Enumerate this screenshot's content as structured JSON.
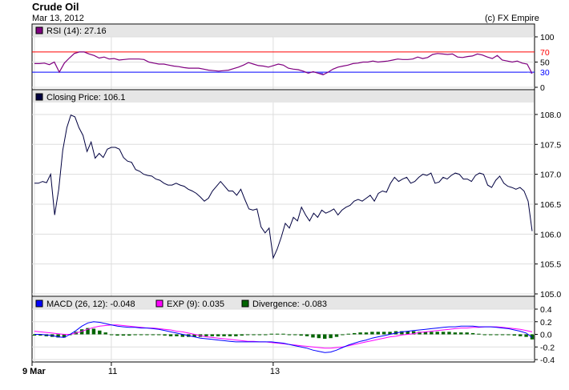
{
  "header": {
    "title": "Crude Oil",
    "date": "Mar 13, 2012",
    "credit": "(c) FX Empire"
  },
  "colors": {
    "rsi": "#800080",
    "price": "#000040",
    "macd": "#0000ff",
    "exp": "#ff00ff",
    "divergence": "#006400",
    "overbought": "#ff0000",
    "oversold": "#0000ff",
    "legend_bg": "#e6e6e6",
    "grid": "#dddddd"
  },
  "x_axis": {
    "ticks": [
      {
        "label": "9 Mar",
        "index": 0
      },
      {
        "label": "11",
        "index": 19
      },
      {
        "label": "13",
        "index": 59
      }
    ]
  },
  "chart_data": [
    {
      "type": "line",
      "legend": "RSI (14): 27.16",
      "ylim": [
        0,
        100
      ],
      "yticks": [
        0,
        50,
        100
      ],
      "level_labels": [
        70,
        30
      ],
      "overbought": 70,
      "oversold": 30,
      "values": [
        47,
        47,
        48,
        45,
        50,
        30,
        48,
        58,
        67,
        70,
        70,
        66,
        63,
        58,
        60,
        56,
        57,
        54,
        55,
        56,
        56,
        56,
        55,
        50,
        48,
        46,
        46,
        44,
        42,
        41,
        39,
        38,
        38,
        38,
        36,
        34,
        33,
        32,
        33,
        34,
        37,
        40,
        44,
        49,
        46,
        43,
        42,
        40,
        43,
        46,
        44,
        38,
        36,
        35,
        32,
        28,
        31,
        28,
        25,
        30,
        36,
        40,
        42,
        44,
        47,
        48,
        50,
        50,
        52,
        50,
        51,
        52,
        54,
        56,
        55,
        55,
        56,
        60,
        57,
        59,
        65,
        67,
        66,
        65,
        66,
        60,
        59,
        61,
        62,
        66,
        64,
        60,
        57,
        63,
        54,
        52,
        50,
        52,
        48,
        46,
        27
      ]
    },
    {
      "type": "line",
      "legend": "Closing Price: 106.1",
      "ylim": [
        105.0,
        108.2
      ],
      "yticks": [
        105.0,
        105.5,
        106.0,
        106.5,
        107.0,
        107.5,
        108.0
      ],
      "values": [
        106.85,
        106.85,
        106.88,
        106.86,
        107.0,
        106.32,
        106.75,
        107.4,
        107.78,
        107.99,
        107.96,
        107.78,
        107.65,
        107.38,
        107.54,
        107.27,
        107.35,
        107.28,
        107.42,
        107.45,
        107.45,
        107.42,
        107.28,
        107.22,
        107.2,
        107.08,
        107.05,
        107.0,
        106.98,
        106.97,
        106.92,
        106.9,
        106.85,
        106.82,
        106.82,
        106.85,
        106.82,
        106.8,
        106.75,
        106.72,
        106.68,
        106.62,
        106.55,
        106.6,
        106.72,
        106.8,
        106.88,
        106.8,
        106.72,
        106.72,
        106.65,
        106.75,
        106.58,
        106.42,
        106.4,
        106.42,
        106.12,
        106.02,
        106.1,
        105.6,
        105.75,
        105.95,
        106.18,
        106.1,
        106.28,
        106.22,
        106.45,
        106.32,
        106.22,
        106.35,
        106.28,
        106.4,
        106.35,
        106.38,
        106.42,
        106.32,
        106.4,
        106.45,
        106.48,
        106.55,
        106.58,
        106.55,
        106.6,
        106.65,
        106.55,
        106.68,
        106.72,
        106.7,
        106.85,
        106.95,
        106.88,
        106.92,
        106.95,
        106.85,
        106.88,
        106.95,
        107.0,
        106.98,
        107.02,
        106.85,
        106.87,
        106.95,
        106.92,
        106.98,
        107.02,
        107.0,
        106.92,
        106.92,
        106.88,
        106.98,
        107.02,
        107.0,
        106.82,
        106.78,
        106.9,
        106.97,
        106.85,
        106.8,
        106.78,
        106.75,
        106.78,
        106.72,
        106.55,
        106.05
      ]
    },
    {
      "type": "line",
      "legend": "MACD (26, 12): -0.048",
      "legend_exp": "EXP (9): 0.035",
      "legend_div": "Divergence: -0.083",
      "ylim": [
        -0.4,
        0.4
      ],
      "yticks": [
        -0.4,
        -0.2,
        0.0,
        0.2,
        0.4
      ],
      "macd": [
        0.0,
        0.0,
        -0.01,
        -0.02,
        -0.04,
        -0.05,
        0.0,
        0.06,
        0.13,
        0.18,
        0.2,
        0.19,
        0.17,
        0.15,
        0.13,
        0.12,
        0.11,
        0.11,
        0.1,
        0.1,
        0.09,
        0.08,
        0.06,
        0.04,
        0.02,
        0.0,
        -0.02,
        -0.04,
        -0.06,
        -0.07,
        -0.08,
        -0.09,
        -0.1,
        -0.11,
        -0.12,
        -0.12,
        -0.12,
        -0.12,
        -0.12,
        -0.12,
        -0.12,
        -0.13,
        -0.14,
        -0.16,
        -0.18,
        -0.2,
        -0.22,
        -0.25,
        -0.27,
        -0.29,
        -0.28,
        -0.25,
        -0.21,
        -0.17,
        -0.14,
        -0.11,
        -0.09,
        -0.06,
        -0.04,
        -0.02,
        0.0,
        0.02,
        0.04,
        0.05,
        0.06,
        0.07,
        0.08,
        0.09,
        0.1,
        0.11,
        0.12,
        0.12,
        0.13,
        0.13,
        0.13,
        0.12,
        0.12,
        0.12,
        0.11,
        0.1,
        0.09,
        0.07,
        0.05,
        0.02,
        -0.05
      ],
      "exp": [
        0.05,
        0.04,
        0.03,
        0.02,
        0.01,
        0.0,
        0.0,
        0.02,
        0.05,
        0.08,
        0.11,
        0.13,
        0.14,
        0.15,
        0.15,
        0.14,
        0.13,
        0.12,
        0.11,
        0.1,
        0.1,
        0.09,
        0.08,
        0.07,
        0.05,
        0.04,
        0.02,
        0.0,
        -0.02,
        -0.04,
        -0.05,
        -0.06,
        -0.07,
        -0.08,
        -0.09,
        -0.1,
        -0.11,
        -0.11,
        -0.12,
        -0.12,
        -0.13,
        -0.14,
        -0.15,
        -0.16,
        -0.17,
        -0.18,
        -0.19,
        -0.2,
        -0.21,
        -0.22,
        -0.22,
        -0.21,
        -0.2,
        -0.18,
        -0.16,
        -0.14,
        -0.12,
        -0.1,
        -0.08,
        -0.06,
        -0.04,
        -0.03,
        -0.01,
        0.0,
        0.01,
        0.03,
        0.04,
        0.05,
        0.06,
        0.07,
        0.08,
        0.09,
        0.1,
        0.1,
        0.11,
        0.11,
        0.12,
        0.12,
        0.12,
        0.11,
        0.1,
        0.09,
        0.08,
        0.06,
        0.04
      ],
      "divergence": [
        -0.02,
        -0.02,
        -0.03,
        -0.04,
        -0.05,
        -0.05,
        0.0,
        0.04,
        0.08,
        0.1,
        0.09,
        0.06,
        0.03,
        0.0,
        -0.02,
        -0.02,
        -0.02,
        -0.01,
        -0.01,
        0.0,
        -0.01,
        -0.01,
        -0.02,
        -0.03,
        -0.03,
        -0.04,
        -0.04,
        -0.04,
        -0.04,
        -0.03,
        -0.03,
        -0.03,
        -0.03,
        -0.03,
        -0.03,
        -0.02,
        -0.01,
        -0.01,
        0.0,
        0.0,
        0.01,
        0.01,
        0.01,
        0.0,
        -0.01,
        -0.02,
        -0.03,
        -0.05,
        -0.06,
        -0.07,
        -0.06,
        -0.04,
        -0.01,
        0.01,
        0.02,
        0.03,
        0.03,
        0.04,
        0.04,
        0.04,
        0.04,
        0.05,
        0.05,
        0.05,
        0.05,
        0.04,
        0.04,
        0.04,
        0.04,
        0.04,
        0.04,
        0.03,
        0.03,
        0.03,
        0.02,
        0.01,
        0.0,
        0.0,
        -0.01,
        -0.01,
        -0.01,
        -0.02,
        -0.03,
        -0.04,
        -0.08
      ]
    }
  ]
}
